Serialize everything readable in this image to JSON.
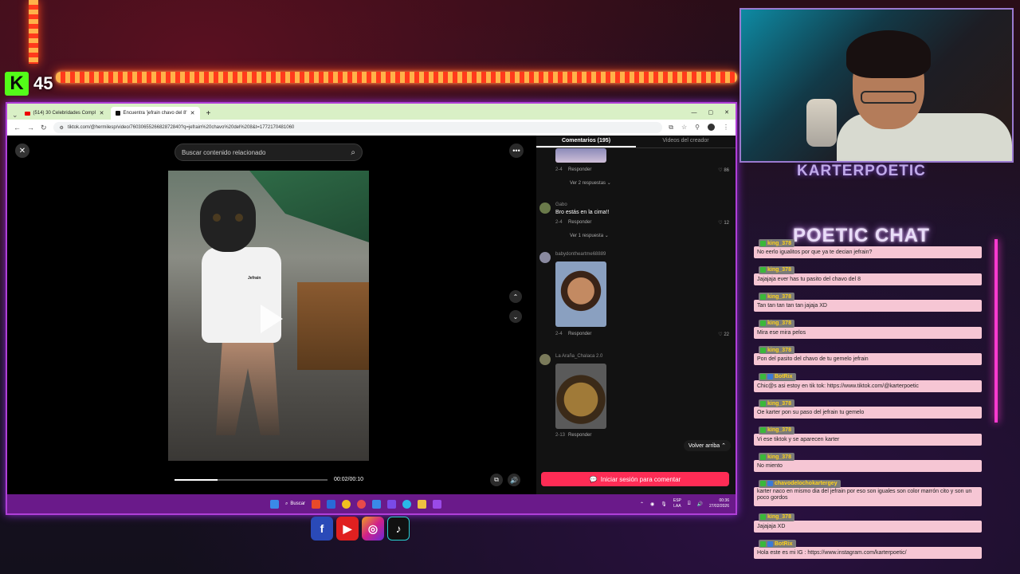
{
  "kick": {
    "logo": "K",
    "viewers": "45"
  },
  "browser": {
    "tabs": [
      {
        "title": "(514) 30 Celebridades Compl",
        "icon": "youtube-icon"
      },
      {
        "title": "Encuentra 'jefrain chavo del 8'",
        "icon": "tiktok-icon"
      }
    ],
    "url": "tiktok.com/@hermilesp/video/7603065526682872840?q=jefrain%20chavo%20del%208&t=1772170481060"
  },
  "tiktok": {
    "search_placeholder": "Buscar contenido relacionado",
    "shirt_text": "Jefrain",
    "time": "00:02/00:10",
    "progress": 0.28,
    "tabs": [
      "Comentarios (195)",
      "Videos del creador"
    ],
    "comments": [
      {
        "user": "",
        "text": "",
        "date": "2-4",
        "reply": "Responder",
        "likes": "86",
        "replies": "Ver 2 respuestas"
      },
      {
        "user": "Gabo",
        "text": "Bro estás en la cima!!",
        "date": "2-4",
        "reply": "Responder",
        "likes": "12",
        "replies": "Ver 1 respuesta"
      },
      {
        "user": "babydontheartme68889",
        "text": "",
        "date": "2-4",
        "reply": "Responder",
        "likes": "22",
        "replies": ""
      },
      {
        "user": "La Araña_Chalaca 2.0",
        "text": "",
        "date": "2-13",
        "reply": "Responder",
        "likes": "",
        "replies": ""
      }
    ],
    "back_to_top": "Volver arriba",
    "login": "Iniciar sesión para comentar"
  },
  "taskbar": {
    "search": "Buscar",
    "lang_top": "ESP",
    "lang_bottom": "LAA",
    "time": "00:36",
    "date": "27/02/2026"
  },
  "streamer": {
    "name": "KARTERPOETIC"
  },
  "chat": {
    "title": "POETIC CHAT",
    "messages": [
      {
        "user": "king_378",
        "text": "No eerlo igualitos por que ya te decian jefrain?"
      },
      {
        "user": "king_378",
        "text": "Jajajaja ever has tu pasito del chavo del 8"
      },
      {
        "user": "king_378",
        "text": "Tan tan tan tan tan jajaja XD"
      },
      {
        "user": "king_378",
        "text": "Mira ese mira pelos"
      },
      {
        "user": "king_378",
        "text": "Pon del pasito del chavo de tu gemelo jefrain"
      },
      {
        "user": "BotRix",
        "text": "Chic@s asi estoy en tik tok: https://www.tiktok.com/@karterpoetic"
      },
      {
        "user": "king_378",
        "text": "Oe karter pon su paso del jefrain tu gemelo"
      },
      {
        "user": "king_378",
        "text": "Vi ese tiktok y se aparecen karter"
      },
      {
        "user": "king_378",
        "text": "No miento"
      },
      {
        "user": "chavodelochokartergey",
        "text": "karter naco en mismo dia del jefrain por eso son iguales son color marrón cito y son un poco gordos"
      },
      {
        "user": "king_378",
        "text": "Jajajaja XD"
      },
      {
        "user": "BotRix",
        "text": "Hola este es mi IG : https://www.instagram.com/karterpoetic/"
      }
    ]
  }
}
